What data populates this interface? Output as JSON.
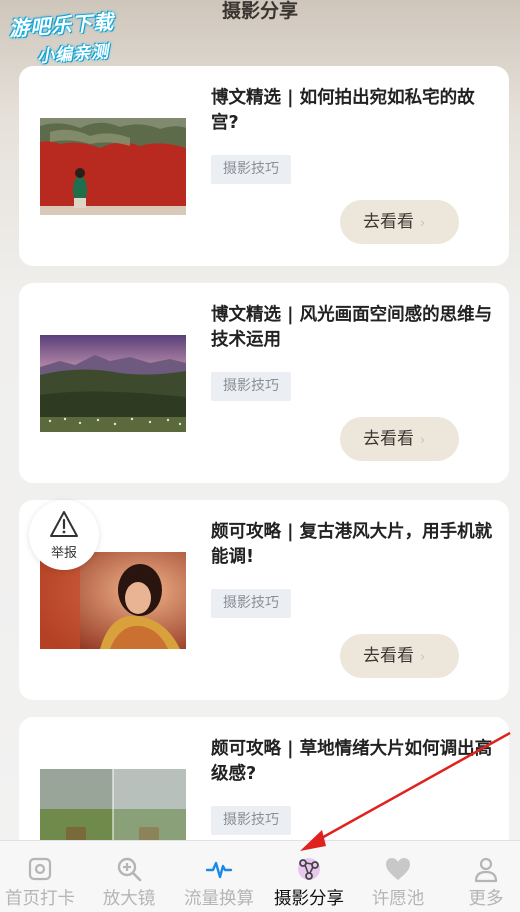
{
  "header": {
    "title": "摄影分享"
  },
  "watermark": {
    "line1": "游吧乐下载",
    "line2": "小编亲测"
  },
  "cards": [
    {
      "title": "博文精选 | 如何拍出宛如私宅的故宫?",
      "tag": "摄影技巧",
      "button": "去看看"
    },
    {
      "title": "博文精选 | 风光画面空间感的思维与技术运用",
      "tag": "摄影技巧",
      "button": "去看看"
    },
    {
      "title": "颇可攻略 | 复古港风大片，用手机就能调!",
      "tag": "摄影技巧",
      "button": "去看看"
    },
    {
      "title": "颇可攻略 | 草地情绪大片如何调出高级感?",
      "tag": "摄影技巧",
      "button": "去看看"
    }
  ],
  "report": {
    "label": "举报",
    "icon": "warning-icon"
  },
  "tabbar": {
    "active": "摄影分享",
    "tabs": [
      {
        "label": "首页打卡",
        "icon": "camera-frame-icon"
      },
      {
        "label": "放大镜",
        "icon": "magnifier-plus-icon"
      },
      {
        "label": "流量换算",
        "icon": "waveform-icon"
      },
      {
        "label": "摄影分享",
        "icon": "share-nodes-icon"
      },
      {
        "label": "许愿池",
        "icon": "heart-icon"
      },
      {
        "label": "更多",
        "icon": "person-icon"
      }
    ]
  },
  "colors": {
    "accent": "#1a8ae6",
    "button_bg": "#ede6da",
    "tag_bg": "#ebeef2",
    "arrow": "#e0221e"
  }
}
